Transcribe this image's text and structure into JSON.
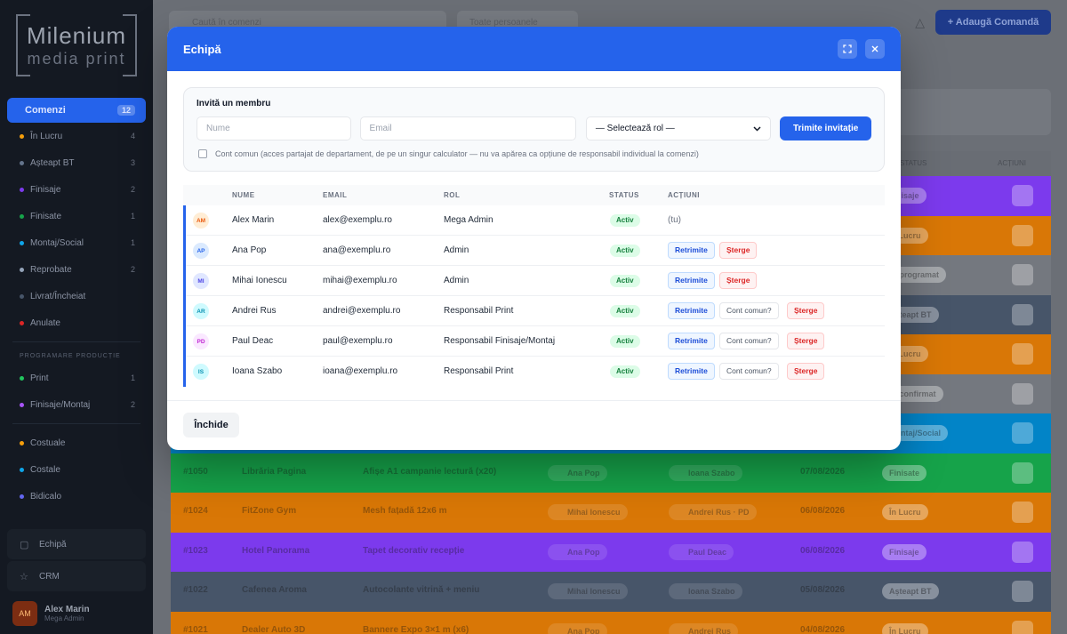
{
  "app": {
    "logo_main": "Milenium",
    "logo_sub": "media print",
    "sidebar": {
      "primary": {
        "label": "Comenzi",
        "count": "12"
      },
      "items": [
        {
          "label": "În Lucru",
          "count": "4",
          "color": "#f59e0b"
        },
        {
          "label": "Așteapt BT",
          "count": "3",
          "color": "#64748b"
        },
        {
          "label": "Finisaje",
          "count": "2",
          "color": "#7c3aed"
        },
        {
          "label": "Finisate",
          "count": "1",
          "color": "#16a34a"
        },
        {
          "label": "Montaj/Social",
          "count": "1",
          "color": "#0ea5e9"
        },
        {
          "label": "Reprobate",
          "count": "2",
          "color": "#94a3b8"
        },
        {
          "label": "Livrat/Încheiat",
          "count": "",
          "color": "#475569"
        },
        {
          "label": "Anulate",
          "count": "",
          "color": "#dc2626"
        }
      ],
      "section_heading": "PROGRAMARE PRODUCȚIE",
      "section_items": [
        {
          "label": "Print",
          "count": "1",
          "color": "#22c55e"
        },
        {
          "label": "Finisaje/Montaj",
          "count": "2",
          "color": "#a855f7"
        }
      ],
      "extra_items": [
        {
          "label": "Costuale",
          "color": "#f59e0b"
        },
        {
          "label": "Costale",
          "color": "#0ea5e9"
        },
        {
          "label": "Bidicalo",
          "color": "#6366f1"
        }
      ],
      "bottom": [
        {
          "label": "Echipă",
          "icon": "team-icon"
        },
        {
          "label": "CRM",
          "icon": "star-icon"
        }
      ],
      "user": {
        "initials": "AM",
        "name": "Alex Marin",
        "role": "Mega Admin"
      }
    },
    "topbar": {
      "search_placeholder": "Caută în comenzi",
      "filter_value": "Toate persoanele",
      "add_button": "+ Adaugă Comandă"
    },
    "bg_table": {
      "headers": [
        "STATUS",
        "ACȚIUNI"
      ],
      "rows": [
        {
          "color": "#7c3aed",
          "id": "",
          "client": "",
          "desc": "",
          "a": "",
          "b": "",
          "date": "",
          "status": "Finisaje"
        },
        {
          "color": "#d97706",
          "id": "",
          "client": "",
          "desc": "",
          "a": "",
          "b": "",
          "date": "",
          "status": "În Lucru"
        },
        {
          "color": "#74787f",
          "id": "",
          "client": "",
          "desc": "",
          "a": "",
          "b": "",
          "date": "",
          "status": "Reprogramat"
        },
        {
          "color": "#475569",
          "id": "",
          "client": "",
          "desc": "",
          "a": "",
          "b": "",
          "date": "",
          "status": "Așteapt BT"
        },
        {
          "color": "#d97706",
          "id": "",
          "client": "",
          "desc": "",
          "a": "",
          "b": "",
          "date": "",
          "status": "În Lucru"
        },
        {
          "color": "#74787f",
          "id": "",
          "client": "",
          "desc": "",
          "a": "",
          "b": "",
          "date": "",
          "status": "Neconfirmat"
        },
        {
          "color": "#0284c7",
          "id": "",
          "client": "",
          "desc": "",
          "a": "",
          "b": "",
          "date": "",
          "status": "Montaj/Social"
        },
        {
          "color": "#16a34a",
          "id": "#1050",
          "client": "Librăria Pagina",
          "desc": "Afișe A1 campanie lectură (x20)",
          "a": "Ana Pop",
          "b": "Ioana Szabo",
          "date": "07/08/2026",
          "status": "Finisate"
        },
        {
          "color": "#d97706",
          "id": "#1024",
          "client": "FitZone Gym",
          "desc": "Mesh fațadă 12x6 m",
          "a": "Mihai Ionescu",
          "b": "Andrei Rus · PD",
          "date": "06/08/2026",
          "status": "În Lucru"
        },
        {
          "color": "#7c3aed",
          "id": "#1023",
          "client": "Hotel Panorama",
          "desc": "Tapet decorativ recepție",
          "a": "Ana Pop",
          "b": "Paul Deac",
          "date": "06/08/2026",
          "status": "Finisaje"
        },
        {
          "color": "#475569",
          "id": "#1022",
          "client": "Cafenea Aroma",
          "desc": "Autocolante vitrină + meniu",
          "a": "Mihai Ionescu",
          "b": "Ioana Szabo",
          "date": "05/08/2026",
          "status": "Așteapt BT"
        },
        {
          "color": "#d97706",
          "id": "#1021",
          "client": "Dealer Auto 3D",
          "desc": "Bannere Expo 3×1 m (x6)",
          "a": "Ana Pop",
          "b": "Andrei Rus",
          "date": "04/08/2026",
          "status": "În Lucru"
        }
      ]
    }
  },
  "modal": {
    "title": "Echipă",
    "invite": {
      "title": "Invită un membru",
      "name_placeholder": "Nume",
      "email_placeholder": "Email",
      "role_select": "— Selectează rol —",
      "send_button": "Trimite invitație",
      "shared_checkbox_label": "Cont comun (acces partajat de departament, de pe un singur calculator — nu va apărea ca opțiune de responsabil individual la comenzi)"
    },
    "table": {
      "headers": {
        "name": "NUME",
        "email": "EMAIL",
        "role": "ROL",
        "status": "STATUS",
        "actions": "ACȚIUNI"
      },
      "rows": [
        {
          "initials": "AM",
          "avatar_bg": "#ffedd5",
          "avatar_fg": "#ea580c",
          "name": "Alex Marin",
          "email": "alex@exemplu.ro",
          "role": "Mega Admin",
          "status": "Activ",
          "you": "(tu)"
        },
        {
          "initials": "AP",
          "avatar_bg": "#dbeafe",
          "avatar_fg": "#2563eb",
          "name": "Ana Pop",
          "email": "ana@exemplu.ro",
          "role": "Admin",
          "status": "Activ",
          "resend": "Retrimite",
          "delete": "Șterge"
        },
        {
          "initials": "MI",
          "avatar_bg": "#e0e7ff",
          "avatar_fg": "#4f46e5",
          "name": "Mihai Ionescu",
          "email": "mihai@exemplu.ro",
          "role": "Admin",
          "status": "Activ",
          "resend": "Retrimite",
          "delete": "Șterge"
        },
        {
          "initials": "AR",
          "avatar_bg": "#cffafe",
          "avatar_fg": "#0891b2",
          "name": "Andrei Rus",
          "email": "andrei@exemplu.ro",
          "role": "Responsabil Print",
          "status": "Activ",
          "resend": "Retrimite",
          "shared": "Cont comun?",
          "delete": "Șterge"
        },
        {
          "initials": "PD",
          "avatar_bg": "#fae8ff",
          "avatar_fg": "#c026d3",
          "name": "Paul Deac",
          "email": "paul@exemplu.ro",
          "role": "Responsabil Finisaje/Montaj",
          "status": "Activ",
          "resend": "Retrimite",
          "shared": "Cont comun?",
          "delete": "Șterge"
        },
        {
          "initials": "IS",
          "avatar_bg": "#cffafe",
          "avatar_fg": "#0891b2",
          "name": "Ioana Szabo",
          "email": "ioana@exemplu.ro",
          "role": "Responsabil Print",
          "status": "Activ",
          "resend": "Retrimite",
          "shared": "Cont comun?",
          "delete": "Șterge"
        }
      ]
    },
    "close_button": "Închide"
  }
}
